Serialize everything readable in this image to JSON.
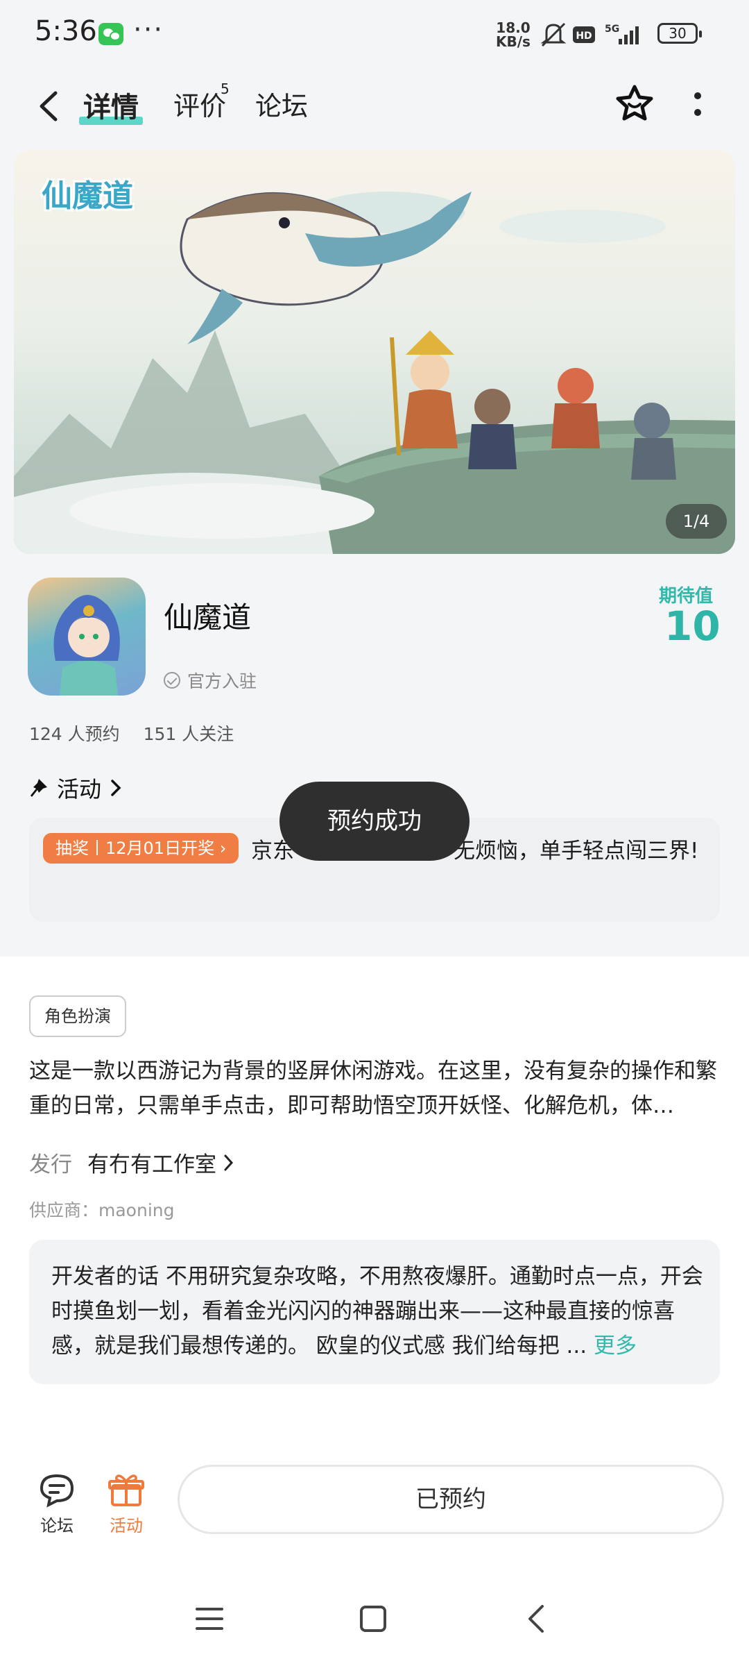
{
  "status_bar": {
    "time": "5:36",
    "net_speed": "18.0",
    "net_speed_unit": "KB/s",
    "battery": "30",
    "icons": [
      "wechat-icon",
      "more-dots-icon",
      "mute-icon",
      "hd-icon",
      "signal-5g-icon",
      "battery-icon"
    ]
  },
  "nav": {
    "tabs": [
      {
        "label": "详情",
        "active": true
      },
      {
        "label": "评价",
        "count": "5"
      },
      {
        "label": "论坛"
      }
    ]
  },
  "banner": {
    "logo_text": "仙魔道",
    "counter": "1/4"
  },
  "game": {
    "name": "仙魔道",
    "official": "官方入驻",
    "expect_label": "期待值",
    "expect_value": "10",
    "reservations": "124 人预约",
    "followers": "151 人关注"
  },
  "activity": {
    "title": "活动",
    "badge": "抽奖丨12月01日开奖",
    "text_before_toast": "京东",
    "text_after_toast": "无烦恼，单手轻点闯三界!"
  },
  "toast": "预约成功",
  "details": {
    "tag": "角色扮演",
    "description": "这是一款以西游记为背景的竖屏休闲游戏。在这里，没有复杂的操作和繁重的日常，只需单手点击，即可帮助悟空顶开妖怪、化解危机，体…",
    "publisher_label": "发行",
    "publisher": "有冇有工作室",
    "supplier": "供应商：maoning",
    "dev_words": "开发者的话  不用研究复杂攻略，不用熬夜爆肝。通勤时点一点，开会时摸鱼划一划，看着金光闪闪的神器蹦出来——这种最直接的惊喜感，就是我们最想传递的。 欧皇的仪式感 我们给每把 ...",
    "more": "更多"
  },
  "bottom": {
    "forum": "论坛",
    "activity": "活动",
    "reserve_button": "已预约"
  },
  "colors": {
    "accent": "#33b9ac",
    "badge": "#f07d44",
    "toast_bg": "#2f2f2f"
  }
}
